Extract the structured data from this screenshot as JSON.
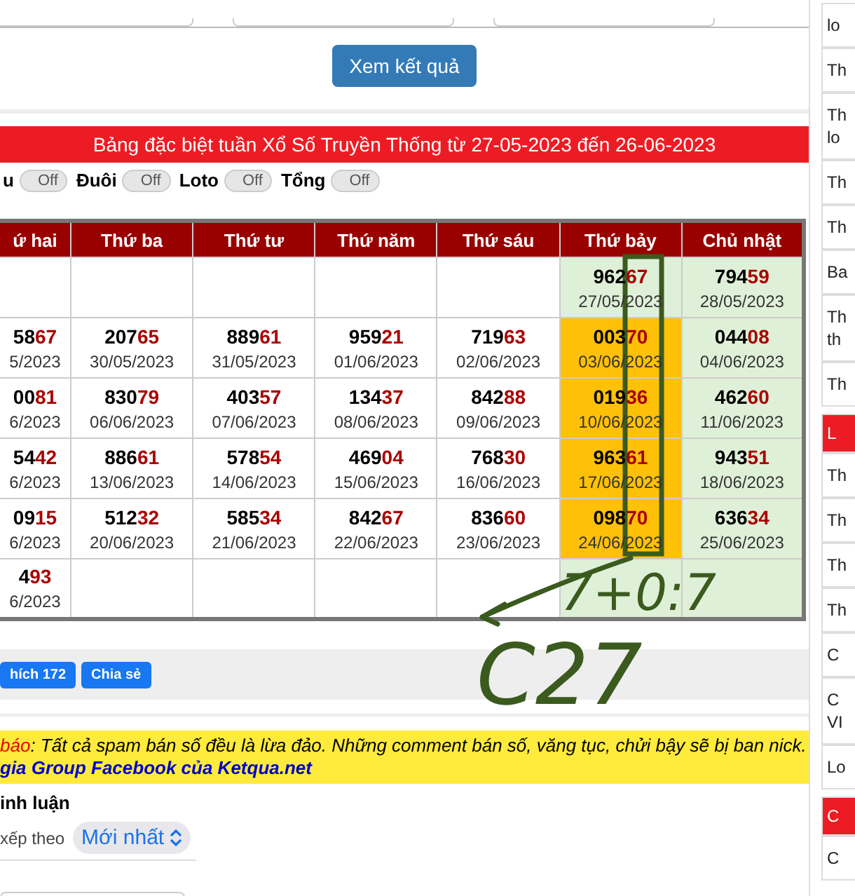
{
  "search_form": {
    "submit": "Xem kết quả"
  },
  "banner": "Bảng đặc biệt tuần Xổ Số Truyền Thống từ 27-05-2023 đến 26-06-2023",
  "toggles": [
    {
      "label": "u",
      "on": false,
      "text": "Off"
    },
    {
      "label": "Đuôi",
      "on": false,
      "text": "Off"
    },
    {
      "label": "Loto",
      "on": false,
      "text": "Off"
    },
    {
      "label": "Tổng",
      "on": false,
      "text": "Off"
    }
  ],
  "table": {
    "columns": [
      {
        "label": "ứ hai",
        "weekend": false
      },
      {
        "label": "Thứ ba",
        "weekend": false
      },
      {
        "label": "Thứ tư",
        "weekend": false
      },
      {
        "label": "Thứ năm",
        "weekend": false
      },
      {
        "label": "Thứ sáu",
        "weekend": false
      },
      {
        "label": "Thứ bảy",
        "weekend": true
      },
      {
        "label": "Chủ nhật",
        "weekend": true
      }
    ],
    "rows": [
      [
        null,
        null,
        null,
        null,
        null,
        {
          "lead": "962",
          "tail": "67",
          "date": "27/05/2023",
          "highlight": false
        },
        {
          "lead": "794",
          "tail": "59",
          "date": "28/05/2023",
          "highlight": false
        }
      ],
      [
        {
          "lead": "58",
          "tail": "67",
          "date": "5/2023",
          "highlight": false
        },
        {
          "lead": "207",
          "tail": "65",
          "date": "30/05/2023",
          "highlight": false
        },
        {
          "lead": "889",
          "tail": "61",
          "date": "31/05/2023",
          "highlight": false
        },
        {
          "lead": "959",
          "tail": "21",
          "date": "01/06/2023",
          "highlight": false
        },
        {
          "lead": "719",
          "tail": "63",
          "date": "02/06/2023",
          "highlight": false
        },
        {
          "lead": "003",
          "tail": "70",
          "date": "03/06/2023",
          "highlight": true
        },
        {
          "lead": "044",
          "tail": "08",
          "date": "04/06/2023",
          "highlight": false
        }
      ],
      [
        {
          "lead": "00",
          "tail": "81",
          "date": "6/2023",
          "highlight": false
        },
        {
          "lead": "830",
          "tail": "79",
          "date": "06/06/2023",
          "highlight": false
        },
        {
          "lead": "403",
          "tail": "57",
          "date": "07/06/2023",
          "highlight": false
        },
        {
          "lead": "134",
          "tail": "37",
          "date": "08/06/2023",
          "highlight": false
        },
        {
          "lead": "842",
          "tail": "88",
          "date": "09/06/2023",
          "highlight": false
        },
        {
          "lead": "019",
          "tail": "36",
          "date": "10/06/2023",
          "highlight": true
        },
        {
          "lead": "462",
          "tail": "60",
          "date": "11/06/2023",
          "highlight": false
        }
      ],
      [
        {
          "lead": "54",
          "tail": "42",
          "date": "6/2023",
          "highlight": false
        },
        {
          "lead": "886",
          "tail": "61",
          "date": "13/06/2023",
          "highlight": false
        },
        {
          "lead": "578",
          "tail": "54",
          "date": "14/06/2023",
          "highlight": false
        },
        {
          "lead": "469",
          "tail": "04",
          "date": "15/06/2023",
          "highlight": false
        },
        {
          "lead": "768",
          "tail": "30",
          "date": "16/06/2023",
          "highlight": false
        },
        {
          "lead": "963",
          "tail": "61",
          "date": "17/06/2023",
          "highlight": true
        },
        {
          "lead": "943",
          "tail": "51",
          "date": "18/06/2023",
          "highlight": false
        }
      ],
      [
        {
          "lead": "09",
          "tail": "15",
          "date": "6/2023",
          "highlight": false
        },
        {
          "lead": "512",
          "tail": "32",
          "date": "20/06/2023",
          "highlight": false
        },
        {
          "lead": "585",
          "tail": "34",
          "date": "21/06/2023",
          "highlight": false
        },
        {
          "lead": "842",
          "tail": "67",
          "date": "22/06/2023",
          "highlight": false
        },
        {
          "lead": "836",
          "tail": "60",
          "date": "23/06/2023",
          "highlight": false
        },
        {
          "lead": "098",
          "tail": "70",
          "date": "24/06/2023",
          "highlight": true
        },
        {
          "lead": "636",
          "tail": "34",
          "date": "25/06/2023",
          "highlight": false
        }
      ],
      [
        {
          "lead": "4",
          "tail": "93",
          "date": "6/2023",
          "highlight": false
        },
        null,
        null,
        null,
        null,
        null,
        null
      ]
    ]
  },
  "annotations": [
    {
      "text": "7+0:7"
    },
    {
      "text": "C27"
    }
  ],
  "share": [
    {
      "label": "hích",
      "count": "172"
    },
    {
      "label": "Chia sẻ"
    }
  ],
  "notice": {
    "warning_word": "báo",
    "text": ": Tất cả spam bán số đều là lừa đảo. Những comment bán số, văng tục, chửi bậy sẽ bị ban nick.",
    "link": "gia Group Facebook của Ketqua.net"
  },
  "comments": {
    "title": "inh luận",
    "sort_label": "xếp theo",
    "sort_value": "Mới nhất"
  },
  "sidebar": [
    {
      "kind": "item",
      "lines": [
        "lo"
      ]
    },
    {
      "kind": "item",
      "lines": [
        "Th"
      ]
    },
    {
      "kind": "item",
      "lines": [
        "Th",
        "lo"
      ]
    },
    {
      "kind": "item",
      "lines": [
        "Th"
      ]
    },
    {
      "kind": "item",
      "lines": [
        "Th"
      ]
    },
    {
      "kind": "item",
      "lines": [
        "Ba"
      ]
    },
    {
      "kind": "item",
      "lines": [
        "Th",
        "th"
      ]
    },
    {
      "kind": "item",
      "lines": [
        "Th"
      ]
    },
    {
      "kind": "header",
      "lines": [
        "L"
      ]
    },
    {
      "kind": "item",
      "lines": [
        "Th"
      ]
    },
    {
      "kind": "item",
      "lines": [
        "Th"
      ]
    },
    {
      "kind": "item",
      "lines": [
        "Th"
      ]
    },
    {
      "kind": "item",
      "lines": [
        "Th"
      ]
    },
    {
      "kind": "item",
      "lines": [
        "C"
      ]
    },
    {
      "kind": "item",
      "lines": [
        "C",
        "VI"
      ]
    },
    {
      "kind": "item",
      "lines": [
        "Lo"
      ]
    },
    {
      "kind": "header",
      "lines": [
        "C"
      ]
    },
    {
      "kind": "item",
      "lines": [
        "C"
      ]
    }
  ]
}
